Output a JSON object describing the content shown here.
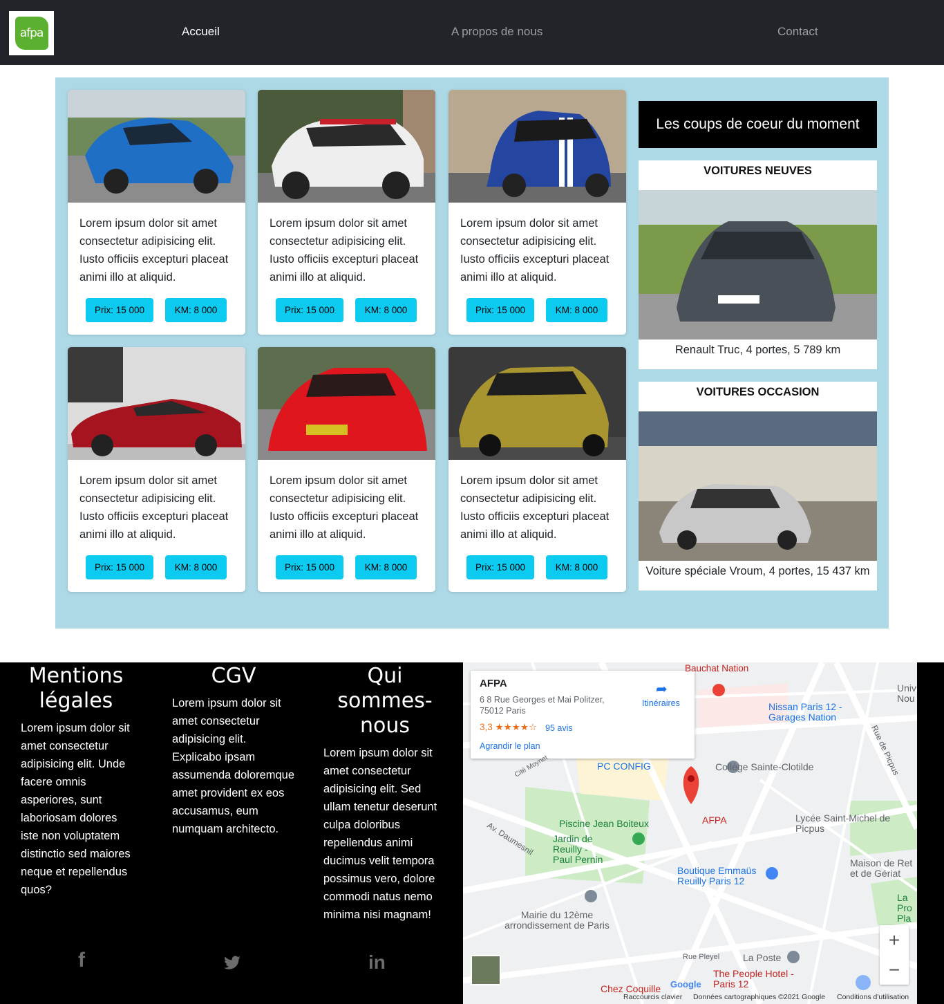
{
  "nav": {
    "logo_text": "afpa",
    "links": [
      "Accueil",
      "A propos de nous",
      "Contact"
    ]
  },
  "cards": [
    {
      "text": "Lorem ipsum dolor sit amet consectetur adipisicing elit. Iusto officiis excepturi placeat animi illo at aliquid.",
      "prix": "Prix: 15 000",
      "km": "KM: 8 000"
    },
    {
      "text": "Lorem ipsum dolor sit amet consectetur adipisicing elit. Iusto officiis excepturi placeat animi illo at aliquid.",
      "prix": "Prix: 15 000",
      "km": "KM: 8 000"
    },
    {
      "text": "Lorem ipsum dolor sit amet consectetur adipisicing elit. Iusto officiis excepturi placeat animi illo at aliquid.",
      "prix": "Prix: 15 000",
      "km": "KM: 8 000"
    },
    {
      "text": "Lorem ipsum dolor sit amet consectetur adipisicing elit. Iusto officiis excepturi placeat animi illo at aliquid.",
      "prix": "Prix: 15 000",
      "km": "KM: 8 000"
    },
    {
      "text": "Lorem ipsum dolor sit amet consectetur adipisicing elit. Iusto officiis excepturi placeat animi illo at aliquid.",
      "prix": "Prix: 15 000",
      "km": "KM: 8 000"
    },
    {
      "text": "Lorem ipsum dolor sit amet consectetur adipisicing elit. Iusto officiis excepturi placeat animi illo at aliquid.",
      "prix": "Prix: 15 000",
      "km": "KM: 8 000"
    }
  ],
  "side": {
    "title": "Les coups de coeur du moment",
    "new": {
      "heading": "VOITURES NEUVES",
      "caption": "Renault Truc, 4 portes, 5 789 km"
    },
    "used": {
      "heading": "VOITURES OCCASION",
      "caption": "Voiture spéciale Vroum, 4 portes, 15 437 km"
    }
  },
  "footer": {
    "cols": [
      {
        "title": "Mentions légales",
        "text": "Lorem ipsum dolor sit amet consectetur adipisicing elit. Unde facere omnis asperiores, sunt laboriosam dolores iste non voluptatem distinctio sed maiores neque et repellendus quos?"
      },
      {
        "title": "CGV",
        "text": "Lorem ipsum dolor sit amet consectetur adipisicing elit. Explicabo ipsam assumenda doloremque amet provident ex eos accusamus, eum numquam architecto."
      },
      {
        "title": "Qui sommes-nous",
        "text": "Lorem ipsum dolor sit amet consectetur adipisicing elit. Sed ullam tenetur deserunt culpa doloribus repellendus animi ducimus velit tempora possimus vero, dolore commodi natus nemo minima nisi magnam!"
      }
    ],
    "social": [
      "facebook-icon",
      "twitter-icon",
      "linkedin-icon"
    ]
  },
  "map": {
    "place_name": "AFPA",
    "address": "6 8 Rue Georges et Mai Politzer, 75012 Paris",
    "rating": "3,3",
    "stars": "★★★★☆",
    "reviews": "95 avis",
    "enlarge": "Agrandir le plan",
    "directions": "Itinéraires",
    "labels": [
      "Bauchat Nation",
      "Nissan Paris 12 - Garages Nation",
      "PC CONFIG",
      "Collège Sainte-Clotilde",
      "Piscine Jean Boiteux",
      "AFPA",
      "Lycée Saint-Michel de Picpus",
      "Jardin de Reuilly - Paul Pernin",
      "Boutique Emmaüs Reuilly Paris 12",
      "Maison de Ret et de Gériat",
      "Mairie du 12ème arrondissement de Paris",
      "La Poste",
      "The People Hotel - Paris 12",
      "Chez Coquille",
      "Av. Daumesnil",
      "Rue de Picpus",
      "Rue Pleyel",
      "Cité Moynet",
      "Univ Nou",
      "La Pro Pla"
    ],
    "footer_links": [
      "Raccourcis clavier",
      "Données cartographiques ©2021 Google",
      "Conditions d'utilisation"
    ],
    "zoom_in": "+",
    "zoom_out": "−"
  },
  "colors": {
    "navbar": "#212529",
    "main_bg": "#add8e6",
    "button": "#0dcaf0",
    "footer": "#000000"
  }
}
